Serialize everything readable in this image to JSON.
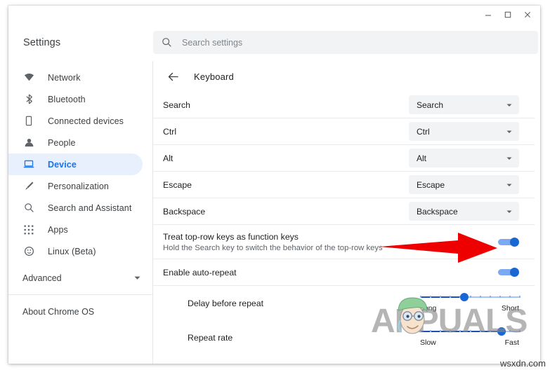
{
  "window": {
    "controls": [
      {
        "name": "minimize",
        "label": "Minimize"
      },
      {
        "name": "maximize",
        "label": "Maximize"
      },
      {
        "name": "close",
        "label": "Close"
      }
    ]
  },
  "topbar": {
    "brand": "Settings",
    "search_placeholder": "Search settings",
    "search_value": "",
    "search_icon": "search-icon"
  },
  "sidebar": {
    "items": [
      {
        "label": "Network",
        "icon": "wifi-icon",
        "selected": false
      },
      {
        "label": "Bluetooth",
        "icon": "bluetooth-icon",
        "selected": false
      },
      {
        "label": "Connected devices",
        "icon": "phone-icon",
        "selected": false
      },
      {
        "label": "People",
        "icon": "person-icon",
        "selected": false
      },
      {
        "label": "Device",
        "icon": "laptop-icon",
        "selected": true
      },
      {
        "label": "Personalization",
        "icon": "brush-icon",
        "selected": false
      },
      {
        "label": "Search and Assistant",
        "icon": "search-icon",
        "selected": false
      },
      {
        "label": "Apps",
        "icon": "grid-apps-icon",
        "selected": false
      },
      {
        "label": "Linux (Beta)",
        "icon": "linux-penguin-icon",
        "selected": false
      }
    ],
    "advanced": {
      "label": "Advanced",
      "icon": "chevron-down-icon"
    },
    "about": {
      "label": "About Chrome OS"
    }
  },
  "main": {
    "back_icon": "back-arrow-icon",
    "page_title": "Keyboard",
    "key_rows": [
      {
        "label": "Search",
        "value": "Search"
      },
      {
        "label": "Ctrl",
        "value": "Ctrl"
      },
      {
        "label": "Alt",
        "value": "Alt"
      },
      {
        "label": "Escape",
        "value": "Escape"
      },
      {
        "label": "Backspace",
        "value": "Backspace"
      }
    ],
    "toggle_rows": [
      {
        "label": "Treat top-row keys as function keys",
        "sublabel": "Hold the Search key to switch the behavior of the top-row keys",
        "on": true
      },
      {
        "label": "Enable auto-repeat",
        "sublabel": "",
        "on": true
      }
    ],
    "slider_rows": [
      {
        "label": "Delay before repeat",
        "min_label": "Long",
        "max_label": "Short",
        "percent": 45
      },
      {
        "label": "Repeat rate",
        "min_label": "Slow",
        "max_label": "Fast",
        "percent": 82
      }
    ]
  },
  "annotations": {
    "arrow_color": "#ee0000",
    "arrow_target": "treat-top-row-keys-toggle"
  },
  "watermark": {
    "text": "APPUALS",
    "site_credit": "wsxdn.com"
  },
  "colors": {
    "accent": "#1a73e8",
    "selected_bg": "#e8f0fe",
    "field_bg": "#f1f3f4",
    "toggle_on": "#1967d2",
    "divider": "#e8eaed"
  }
}
